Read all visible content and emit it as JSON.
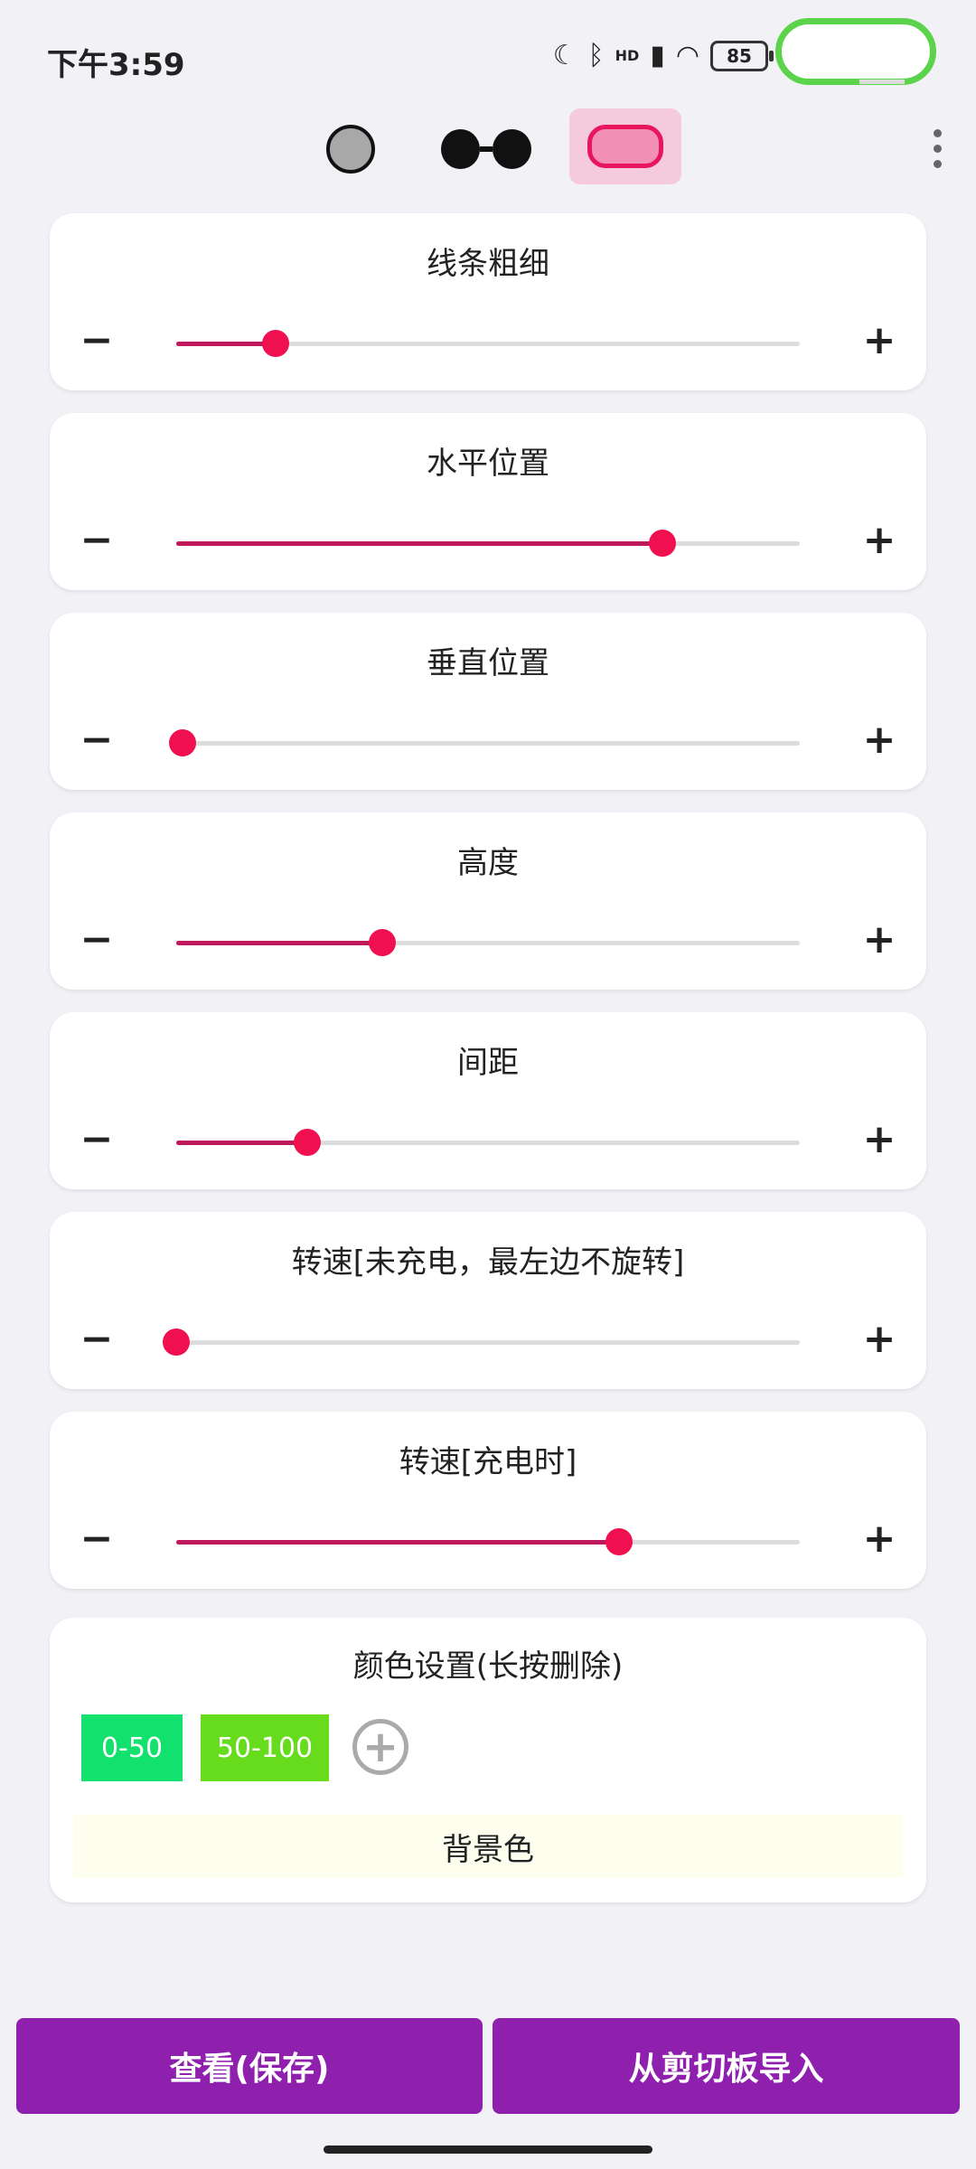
{
  "status_bar": {
    "time": "下午3:59",
    "signal_badge": "HD",
    "battery_level": "85"
  },
  "style_bar": {
    "styles": [
      "circle",
      "glasses",
      "capsule"
    ],
    "selected_style": "capsule",
    "accent_color": "#e8175d"
  },
  "sliders": [
    {
      "label": "线条粗细",
      "minus": "−",
      "plus": "+",
      "value": 0.16
    },
    {
      "label": "水平位置",
      "minus": "−",
      "plus": "+",
      "value": 0.78
    },
    {
      "label": "垂直位置",
      "minus": "−",
      "plus": "+",
      "value": 0.01
    },
    {
      "label": "高度",
      "minus": "−",
      "plus": "+",
      "value": 0.33
    },
    {
      "label": "间距",
      "minus": "−",
      "plus": "+",
      "value": 0.21
    },
    {
      "label": "转速[未充电，最左边不旋转]",
      "minus": "−",
      "plus": "+",
      "value": 0.0
    },
    {
      "label": "转速[充电时]",
      "minus": "−",
      "plus": "+",
      "value": 0.71
    }
  ],
  "color_settings": {
    "title": "颜色设置(长按删除)",
    "chips": [
      {
        "label": "0-50",
        "color": "#12e16d"
      },
      {
        "label": "50-100",
        "color": "#67dc1d"
      }
    ],
    "add_label": "+",
    "background_label": "背景色",
    "background_color": "#fdfeed"
  },
  "actions": {
    "view_save": "查看(保存)",
    "import_clipboard": "从剪切板导入",
    "button_color": "#8e20ad"
  }
}
